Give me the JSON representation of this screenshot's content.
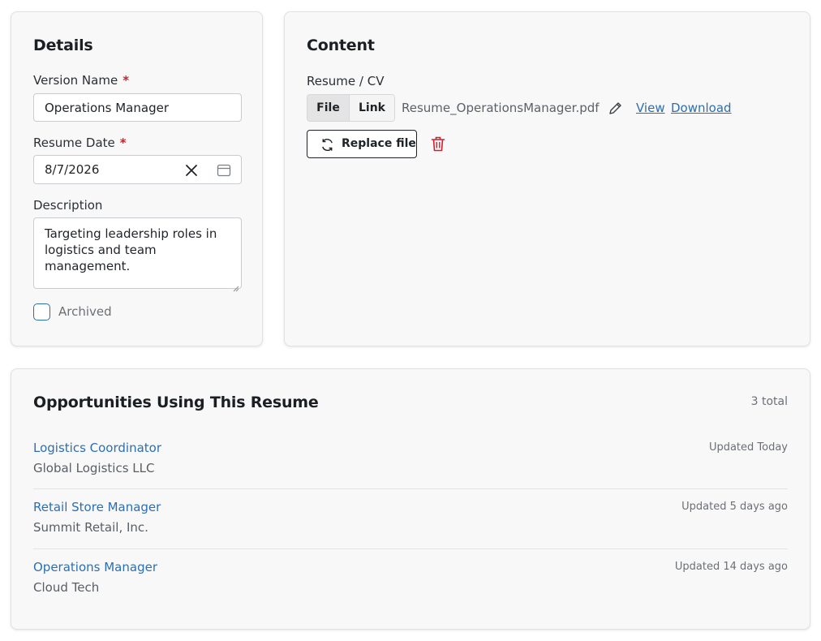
{
  "details": {
    "title": "Details",
    "version_name_label": "Version Name",
    "version_name_value": "Operations Manager",
    "resume_date_label": "Resume Date",
    "resume_date_value": "8/7/2026",
    "description_label": "Description",
    "description_value": "Targeting leadership roles in logistics and team management.",
    "archived_label": "Archived",
    "archived_checked": false,
    "required_marker": "*"
  },
  "content": {
    "title": "Content",
    "resume_label": "Resume / CV",
    "tabs": [
      {
        "label": "File",
        "active": true
      },
      {
        "label": "Link",
        "active": false
      }
    ],
    "file_name": "Resume_OperationsManager.pdf",
    "view_label": "View",
    "download_label": "Download",
    "replace_label": "Replace file"
  },
  "opportunities": {
    "title": "Opportunities Using This Resume",
    "total": "3 total",
    "items": [
      {
        "title": "Logistics Coordinator",
        "company": "Global Logistics LLC",
        "updated": "Updated Today"
      },
      {
        "title": "Retail Store Manager",
        "company": "Summit Retail, Inc.",
        "updated": "Updated 5 days ago"
      },
      {
        "title": "Operations Manager",
        "company": "Cloud Tech",
        "updated": "Updated 14 days ago"
      }
    ]
  },
  "colors": {
    "accent": "#2c6fb0",
    "danger": "#d0202b",
    "card_bg": "#f8f8f8"
  },
  "icons": [
    "close-icon",
    "calendar-icon",
    "pencil-icon",
    "refresh-icon",
    "trash-icon"
  ]
}
